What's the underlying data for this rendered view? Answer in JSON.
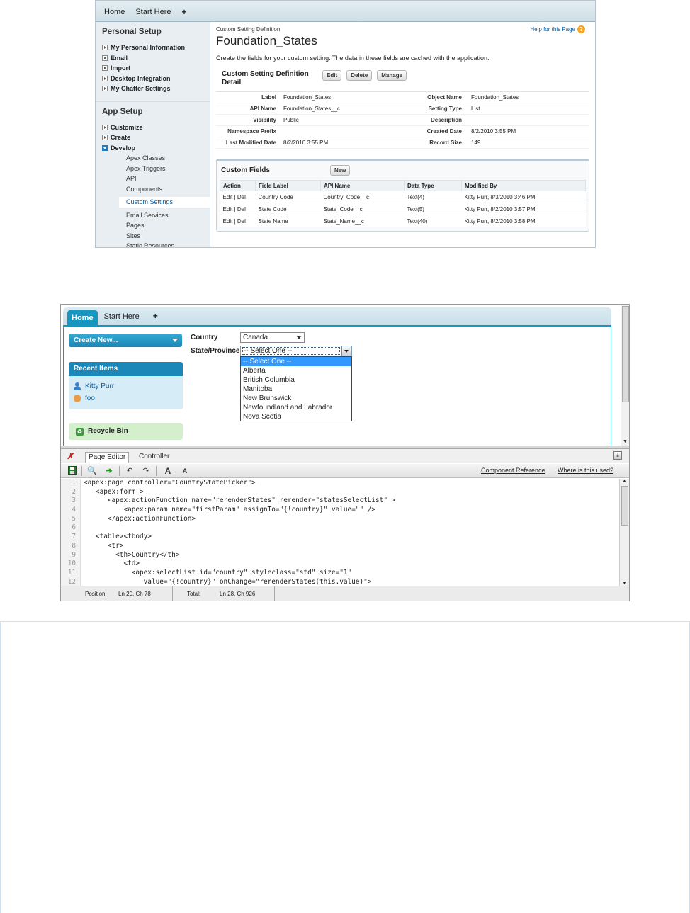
{
  "setup_page": {
    "tabs": [
      "Home",
      "Start Here",
      "+"
    ],
    "sidebar": {
      "personal_setup": {
        "heading": "Personal Setup",
        "items": [
          "My Personal Information",
          "Email",
          "Import",
          "Desktop Integration",
          "My Chatter Settings"
        ]
      },
      "app_setup": {
        "heading": "App Setup",
        "items": [
          "Customize",
          "Create",
          "Develop"
        ],
        "develop_items": [
          "Apex Classes",
          "Apex Triggers",
          "API",
          "Components"
        ],
        "selected_item": "Custom Settings",
        "more_items": [
          "Email Services",
          "Pages",
          "Sites",
          "Static Resources"
        ]
      }
    },
    "breadcrumb": "Custom Setting Definition",
    "title": "Foundation_States",
    "help_link": "Help for this Page",
    "description": "Create the fields for your custom setting. The data in these fields are cached with the application.",
    "detail": {
      "title": "Custom Setting Definition Detail",
      "buttons": [
        "Edit",
        "Delete",
        "Manage"
      ],
      "rows": [
        {
          "label": "Label",
          "value": "Foundation_States",
          "label2": "Object Name",
          "value2": "Foundation_States"
        },
        {
          "label": "API Name",
          "value": "Foundation_States__c",
          "label2": "Setting Type",
          "value2": "List"
        },
        {
          "label": "Visibility",
          "value": "Public",
          "label2": "Description",
          "value2": ""
        },
        {
          "label": "Namespace Prefix",
          "value": "",
          "label2": "Created Date",
          "value2": "8/2/2010 3:55 PM"
        },
        {
          "label": "Last Modified Date",
          "value": "8/2/2010 3:55 PM",
          "label2": "Record Size",
          "value2": "149"
        }
      ]
    },
    "custom_fields": {
      "title": "Custom Fields",
      "new_button": "New",
      "columns": [
        "Action",
        "Field Label",
        "API Name",
        "Data Type",
        "Modified By"
      ],
      "action_edit": "Edit",
      "action_sep": "|",
      "action_del": "Del",
      "rows": [
        {
          "label": "Country Code",
          "api": "Country_Code__c",
          "type": "Text(4)",
          "user": "Kitty Purr",
          "date": ", 8/3/2010 3:46 PM"
        },
        {
          "label": "State Code",
          "api": "State_Code__c",
          "type": "Text(5)",
          "user": "Kitty Purr",
          "date": ", 8/2/2010 3:57 PM"
        },
        {
          "label": "State Name",
          "api": "State_Name__c",
          "type": "Text(40)",
          "user": "Kitty Purr",
          "date": ", 8/2/2010 3:58 PM"
        }
      ]
    }
  },
  "vf_page": {
    "tabs": [
      "Home",
      "Start Here",
      "+"
    ],
    "create_new": "Create New...",
    "recent_items": {
      "heading": "Recent Items",
      "items": [
        "Kitty Purr",
        "foo"
      ]
    },
    "recycle_bin": "Recycle Bin",
    "form": {
      "country_label": "Country",
      "country_value": "Canada",
      "state_label": "State/Province",
      "state_value": "-- Select One --",
      "options": [
        "-- Select One --",
        "Alberta",
        "British Columbia",
        "Manitoba",
        "New Brunswick",
        "Newfoundland and Labrador",
        "Nova Scotia"
      ]
    },
    "editor": {
      "tabs": [
        "Page Editor",
        "Controller"
      ],
      "links": [
        "Component Reference",
        "Where is this used?"
      ],
      "bold_a": "A",
      "small_a": "A",
      "code_lines": [
        "<apex:page controller=\"CountryStatePicker\">",
        "   <apex:form >",
        "      <apex:actionFunction name=\"rerenderStates\" rerender=\"statesSelectList\" >",
        "          <apex:param name=\"firstParam\" assignTo=\"{!country}\" value=\"\" />",
        "      </apex:actionFunction>",
        "",
        "   <table><tbody>",
        "      <tr>",
        "        <th>Country</th>",
        "          <td>",
        "            <apex:selectList id=\"country\" styleclass=\"std\" size=\"1\"",
        "               value=\"{!country}\" onChange=\"rerenderStates(this.value)\">"
      ],
      "status": {
        "position_label": "Position:",
        "position_value": "Ln 20, Ch 78",
        "total_label": "Total:",
        "total_value": "Ln 28, Ch 926"
      }
    }
  },
  "colors": {
    "accent": "#1797c0",
    "link": "#015ba7",
    "recycle_bg": "#d3efcb",
    "recent_bg": "#d6ecf6"
  }
}
